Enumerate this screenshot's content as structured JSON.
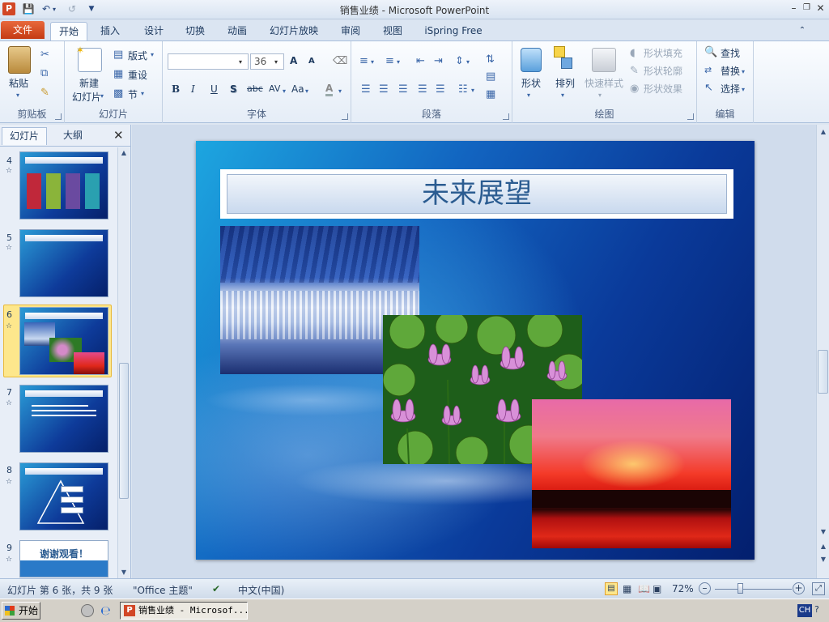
{
  "window": {
    "title": "销售业绩 - Microsoft PowerPoint",
    "app_icon": "P"
  },
  "quick_access": {
    "save_icon": "save-icon",
    "undo_icon": "undo-icon",
    "redo_icon": "redo-icon",
    "customize_icon": "customize-qat-icon"
  },
  "tabs": {
    "file": "文件",
    "items": [
      "开始",
      "插入",
      "设计",
      "切换",
      "动画",
      "幻灯片放映",
      "审阅",
      "视图",
      "iSpring Free"
    ],
    "active_index": 0
  },
  "ribbon": {
    "clipboard": {
      "label": "剪贴板",
      "paste": "粘贴"
    },
    "slides": {
      "label": "幻灯片",
      "new_slide_line1": "新建",
      "new_slide_line2": "幻灯片",
      "layout": "版式",
      "reset": "重设",
      "section": "节"
    },
    "font": {
      "label": "字体",
      "font_name": "",
      "font_size": "36",
      "bold": "B",
      "italic": "I",
      "underline": "U",
      "shadow": "S",
      "strike": "abc",
      "spacing": "AV",
      "case": "Aa",
      "grow": "A",
      "shrink": "A",
      "color": "A"
    },
    "paragraph": {
      "label": "段落"
    },
    "drawing": {
      "label": "绘图",
      "shapes": "形状",
      "arrange": "排列",
      "quick_styles": "快速样式",
      "shape_fill": "形状填充",
      "shape_outline": "形状轮廓",
      "shape_effects": "形状效果"
    },
    "editing": {
      "label": "编辑",
      "find": "查找",
      "replace": "替换",
      "select": "选择"
    }
  },
  "left_pane": {
    "tab_slides": "幻灯片",
    "tab_outline": "大纲",
    "close_icon": "close-icon",
    "thumbnails": [
      {
        "number": "4"
      },
      {
        "number": "5"
      },
      {
        "number": "6"
      },
      {
        "number": "7"
      },
      {
        "number": "8"
      },
      {
        "number": "9",
        "text": "谢谢观看！"
      }
    ],
    "selected_number": "6"
  },
  "slide": {
    "title": "未来展望"
  },
  "status_bar": {
    "slide_info": "幻灯片 第 6 张，共 9 张",
    "theme": "\"Office 主题\"",
    "language": "中文(中国)",
    "zoom": "72%",
    "zoom_level": 0.72
  },
  "taskbar": {
    "start": "开始",
    "window_item": "销售业绩 - Microsof...",
    "ime": "CH"
  }
}
